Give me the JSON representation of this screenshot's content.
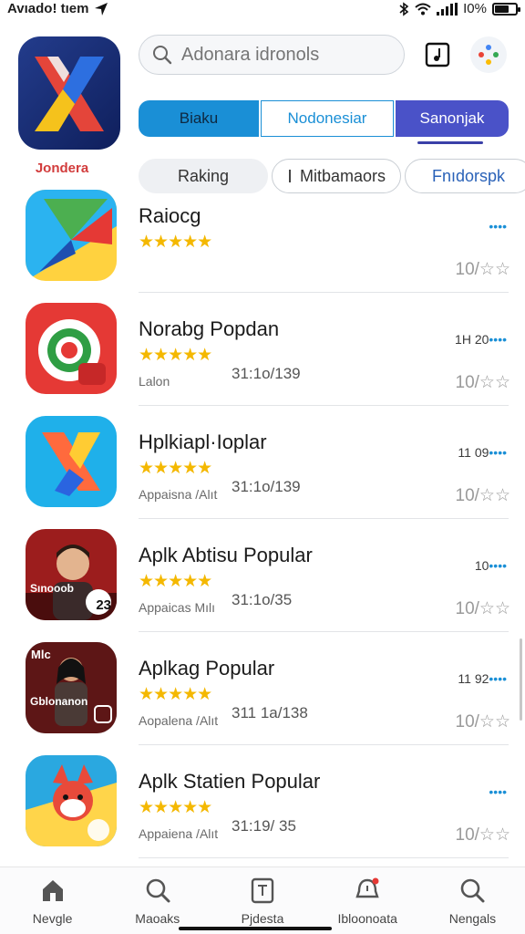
{
  "status": {
    "carrier": "Avıado! tıem",
    "battery_text": "Ι0%",
    "battery_level": 0.7
  },
  "hero": {
    "label": "Jondera",
    "icon": "x-logo-icon"
  },
  "search": {
    "placeholder": "Adonara idronols"
  },
  "header_actions": {
    "music_icon": "music-note-icon",
    "assistant_icon": "assistant-dots-icon"
  },
  "segments": [
    "Biaku",
    "Nodonesiar",
    "Sanonjak"
  ],
  "chips": [
    "Raking",
    "Mitbamaors",
    "Fnıdorspk"
  ],
  "colors": {
    "accent": "#1a8fd6",
    "selected_segment": "#4a52c8",
    "star": "#f4b800"
  },
  "apps": [
    {
      "title": "Raiocg",
      "rating": 4.5,
      "subtitle": "",
      "date": "",
      "count_prefix": "",
      "count_dots": "••••",
      "rate_text": "10/☆☆",
      "icon": "kite-icon"
    },
    {
      "title": "Norabg Popdan",
      "rating": 5,
      "subtitle": "Lalon",
      "date": "31:1o/139",
      "count_prefix": "1H 20",
      "count_dots": "••••",
      "rate_text": "10/☆☆",
      "icon": "camera-ring-icon"
    },
    {
      "title": "Hplkiapl·Ioplar",
      "rating": 4.5,
      "subtitle": "Appaisna /Alıt",
      "date": "31:1o/139",
      "count_prefix": "11 09",
      "count_dots": "••••",
      "rate_text": "10/☆☆",
      "icon": "x-shape-icon"
    },
    {
      "title": "Aplk Abtisu Popular",
      "rating": 4.5,
      "subtitle": "Appaicas Mılı",
      "date": "31:1o/35",
      "count_prefix": "10",
      "count_dots": "••••",
      "rate_text": "10/☆☆",
      "icon": "portrait-icon",
      "badge": "23",
      "overlay": "Sınooob"
    },
    {
      "title": "Aplkag Popular",
      "rating": 4.5,
      "subtitle": "Aopalena /Alıt",
      "date": "311 1a/138",
      "count_prefix": "11 92",
      "count_dots": "••••",
      "rate_text": "10/☆☆",
      "icon": "fighter-icon",
      "overlay_top": "Mlc",
      "overlay": "Gblonanon"
    },
    {
      "title": "Aplk Statien Popular",
      "rating": 4.5,
      "subtitle": "Appaiena /Alıt",
      "date": "31:19/ 35",
      "count_prefix": "",
      "count_dots": "••••",
      "rate_text": "10/☆☆",
      "icon": "fox-cartoon-icon"
    }
  ],
  "nav": [
    {
      "label": "Nevgle",
      "icon": "home-icon"
    },
    {
      "label": "Maoaks",
      "icon": "search-icon"
    },
    {
      "label": "Pjdesta",
      "icon": "document-icon"
    },
    {
      "label": "Ibloonoata",
      "icon": "notification-icon"
    },
    {
      "label": "Nengals",
      "icon": "search-icon"
    }
  ]
}
